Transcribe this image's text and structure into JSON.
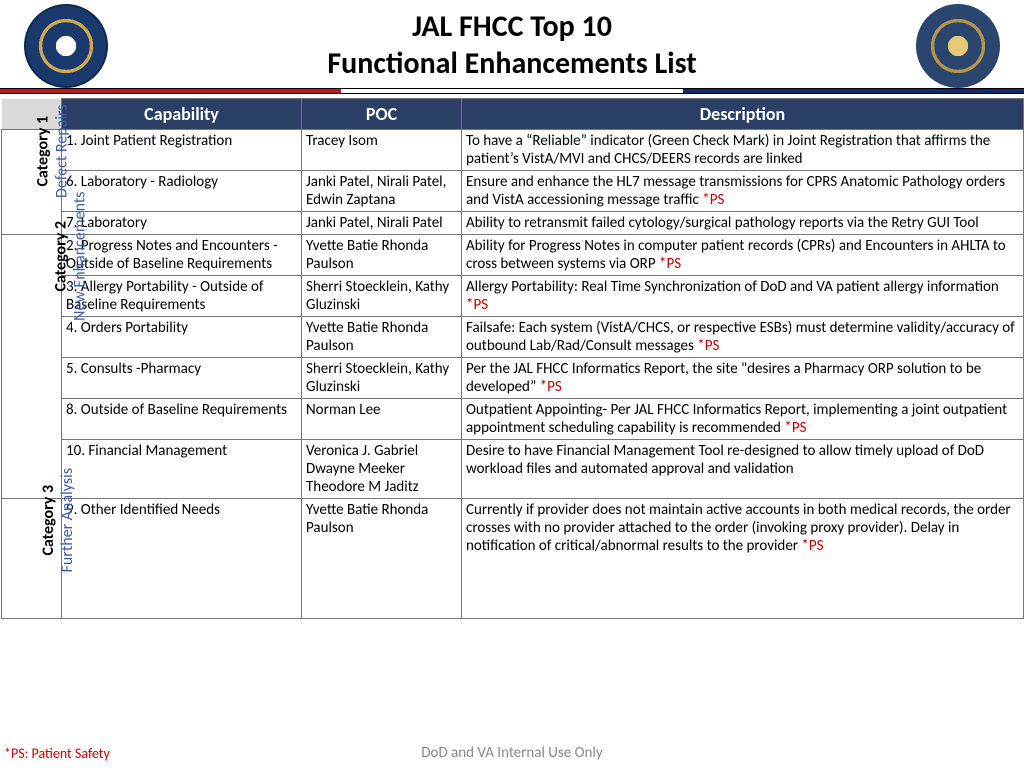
{
  "header": {
    "title1": "JAL FHCC Top 10",
    "title2": "Functional Enhancements List"
  },
  "columns": {
    "capability": "Capability",
    "poc": "POC",
    "description": "Description"
  },
  "categories": [
    {
      "num": "Category 1",
      "label": "Defect Repairs",
      "rows": [
        {
          "cap": "1. Joint Patient Registration",
          "poc": "Tracey Isom",
          "desc": "To have a “Reliable” indicator (Green Check Mark) in Joint Registration that affirms the patient’s VistA/MVI and CHCS/DEERS records are linked",
          "ps": false
        },
        {
          "cap": "6. Laboratory - Radiology",
          "poc": "Janki Patel, Nirali Patel, Edwin Zaptana",
          "desc": "Ensure and enhance the HL7 message transmissions for CPRS Anatomic Pathology orders and VistA accessioning message traffic ",
          "ps": true
        },
        {
          "cap": "7. Laboratory",
          "poc": "Janki Patel, Nirali Patel",
          "desc": "Ability to retransmit failed cytology/surgical pathology reports via the Retry GUI Tool",
          "ps": false
        }
      ]
    },
    {
      "num": "Category 2",
      "label": "New Enhancements",
      "rows": [
        {
          "cap": "2. Progress Notes and Encounters - Outside of Baseline Requirements",
          "poc": "Yvette Batie Rhonda Paulson",
          "desc": "Ability for Progress Notes in computer patient records (CPRs) and Encounters in AHLTA to cross between systems via ORP ",
          "ps": true
        },
        {
          "cap": "3. Allergy Portability - Outside of Baseline Requirements",
          "poc": "Sherri Stoecklein, Kathy Gluzinski",
          "desc": "Allergy Portability:  Real Time Synchronization of DoD and VA patient allergy information ",
          "ps": true
        },
        {
          "cap": "4. Orders Portability",
          "poc": "Yvette Batie Rhonda Paulson",
          "desc": "Failsafe:  Each system (VistA/CHCS, or respective ESBs) must determine validity/accuracy of outbound Lab/Rad/Consult messages ",
          "ps": true
        },
        {
          "cap": "5. Consults -Pharmacy",
          "poc": "Sherri Stoecklein, Kathy Gluzinski",
          "desc": "Per the JAL FHCC Informatics Report, the site \"desires a Pharmacy ORP solution to be developed” ",
          "ps": true
        },
        {
          "cap": "8. Outside of Baseline Requirements",
          "poc": "Norman Lee",
          "desc": "Outpatient Appointing- Per JAL FHCC Informatics Report, implementing a joint outpatient appointment scheduling capability is recommended ",
          "ps": true
        },
        {
          "cap": "10. Financial Management",
          "poc": "Veronica J. Gabriel Dwayne Meeker Theodore M Jaditz",
          "desc": "Desire to have Financial Management Tool re-designed to allow timely upload of DoD workload files and automated approval and validation",
          "ps": false
        }
      ]
    },
    {
      "num": "Category 3",
      "label": "Further Analysis",
      "rows": [
        {
          "cap": "9. Other Identified Needs",
          "poc": "Yvette Batie Rhonda Paulson",
          "desc": "Currently if provider does not maintain active accounts in both medical records, the order crosses with no provider attached to the order (invoking proxy provider).  Delay in notification of critical/abnormal results to the provider ",
          "ps": true,
          "tall": true
        }
      ]
    }
  ],
  "ps_marker": "*PS",
  "footer": {
    "legend": "*PS: Patient Safety",
    "center": "DoD and VA Internal Use Only"
  }
}
